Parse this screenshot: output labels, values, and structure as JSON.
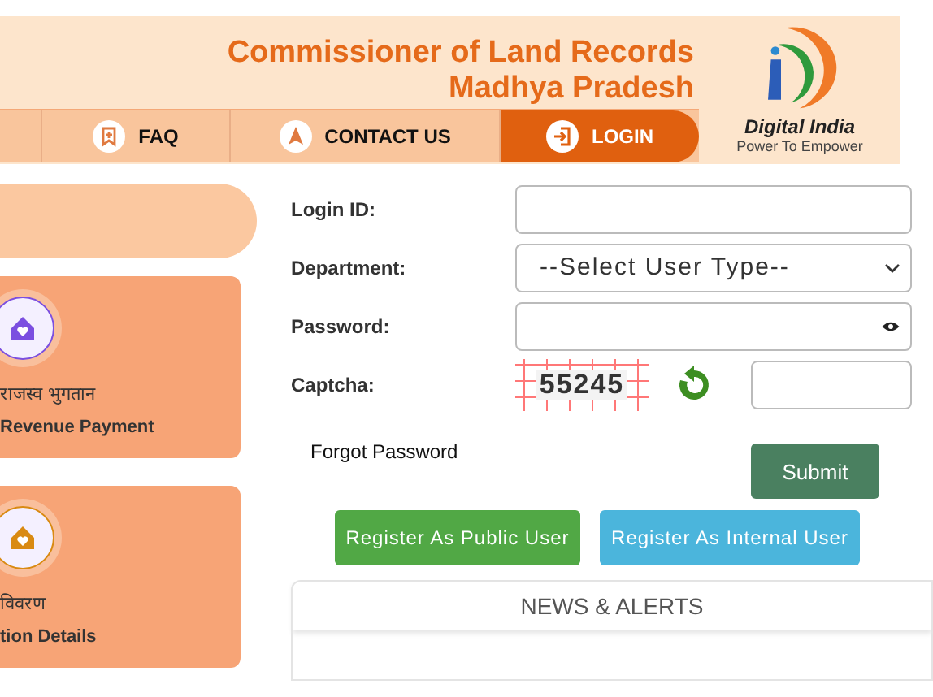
{
  "header": {
    "title_line_1": "Commissioner of Land Records",
    "title_line_2": "Madhya Pradesh",
    "logo_title": "Digital India",
    "logo_tagline": "Power To Empower"
  },
  "nav": [
    {
      "label": "FAQ",
      "kind": "bookmark",
      "selected": false
    },
    {
      "label": "CONTACT US",
      "kind": "navigation",
      "selected": false
    },
    {
      "label": "LOGIN",
      "kind": "login",
      "selected": true
    }
  ],
  "services": [
    {
      "hindi": "राजस्व भुगतान",
      "english": "Revenue Payment",
      "color": "#7b4fe0"
    },
    {
      "hindi": "विवरण",
      "english": "tion Details",
      "color": "#d98a12"
    }
  ],
  "login_form": {
    "login_id_label": "Login ID:",
    "department_label": "Department:",
    "department_value": "--Select User Type--",
    "password_label": "Password:",
    "captcha_label": "Captcha:",
    "captcha_code": "55245",
    "forgot_password": "Forgot Password",
    "submit": "Submit",
    "register_public": "Register As Public User",
    "register_internal": "Register As Internal User"
  },
  "news": {
    "title": "NEWS & ALERTS"
  }
}
